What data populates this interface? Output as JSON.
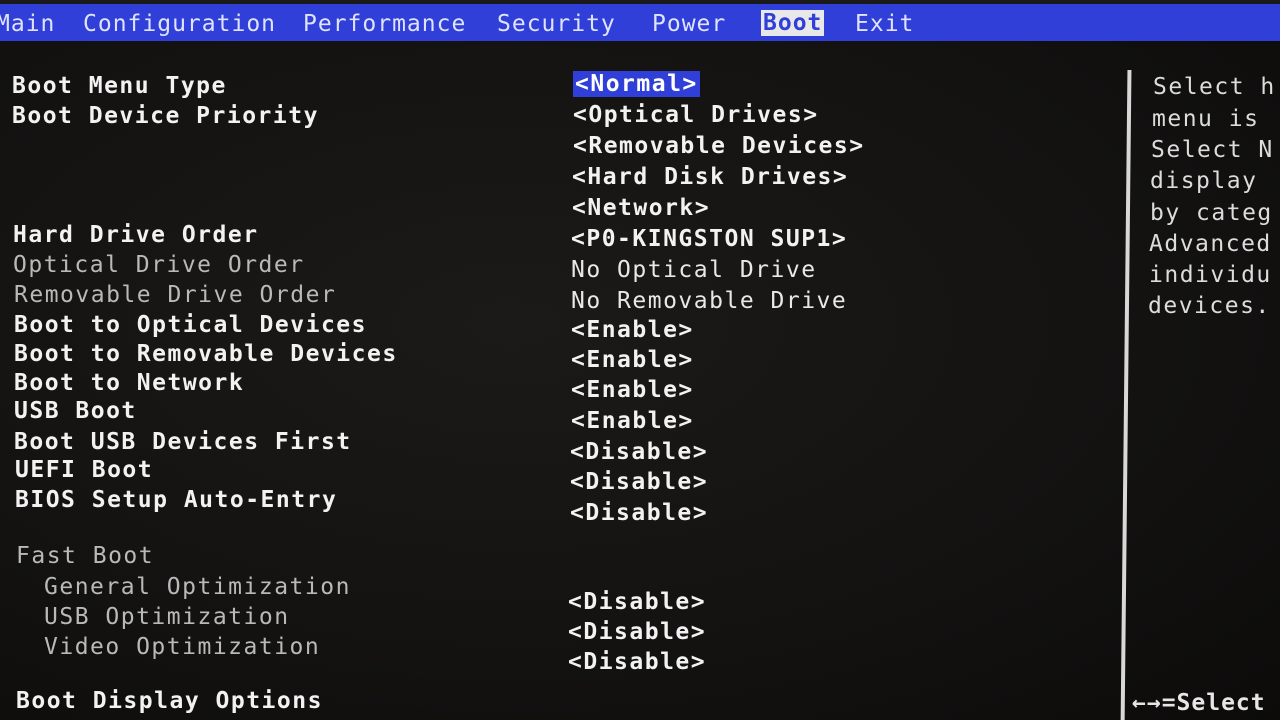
{
  "menu": {
    "items": [
      "Main",
      "Configuration",
      "Performance",
      "Security",
      "Power",
      "Boot",
      "Exit"
    ],
    "active": "Boot"
  },
  "settings": [
    {
      "label": "Boot Menu Type",
      "value": "<Normal>"
    },
    {
      "label": "Boot Device Priority",
      "value": "<Optical Drives>"
    },
    {
      "label": "",
      "value": "<Removable Devices>"
    },
    {
      "label": "",
      "value": "<Hard Disk Drives>"
    },
    {
      "label": "",
      "value": "<Network>"
    },
    {
      "label": "Hard Drive Order",
      "value": "<P0-KINGSTON SUP1>"
    },
    {
      "label": "Optical Drive Order",
      "value": "No Optical Drive"
    },
    {
      "label": "Removable Drive Order",
      "value": "No Removable Drive"
    },
    {
      "label": "Boot to Optical Devices",
      "value": "<Enable>"
    },
    {
      "label": "Boot to Removable Devices",
      "value": "<Enable>"
    },
    {
      "label": "Boot to Network",
      "value": "<Enable>"
    },
    {
      "label": "USB Boot",
      "value": "<Enable>"
    },
    {
      "label": "Boot USB Devices First",
      "value": "<Disable>"
    },
    {
      "label": "UEFI Boot",
      "value": "<Disable>"
    },
    {
      "label": "BIOS Setup Auto-Entry",
      "value": "<Disable>"
    },
    {
      "label": "Fast Boot",
      "value": ""
    },
    {
      "label": "General Optimization",
      "value": "<Disable>"
    },
    {
      "label": "USB Optimization",
      "value": "<Disable>"
    },
    {
      "label": "Video Optimization",
      "value": "<Disable>"
    },
    {
      "label": "Boot Display Options",
      "value": ""
    }
  ],
  "help": {
    "lines": [
      "Select h",
      "menu is",
      "Select N",
      "display",
      "by categ",
      "Advanced",
      "individu",
      "devices."
    ],
    "key_hint": "←→=Select"
  }
}
